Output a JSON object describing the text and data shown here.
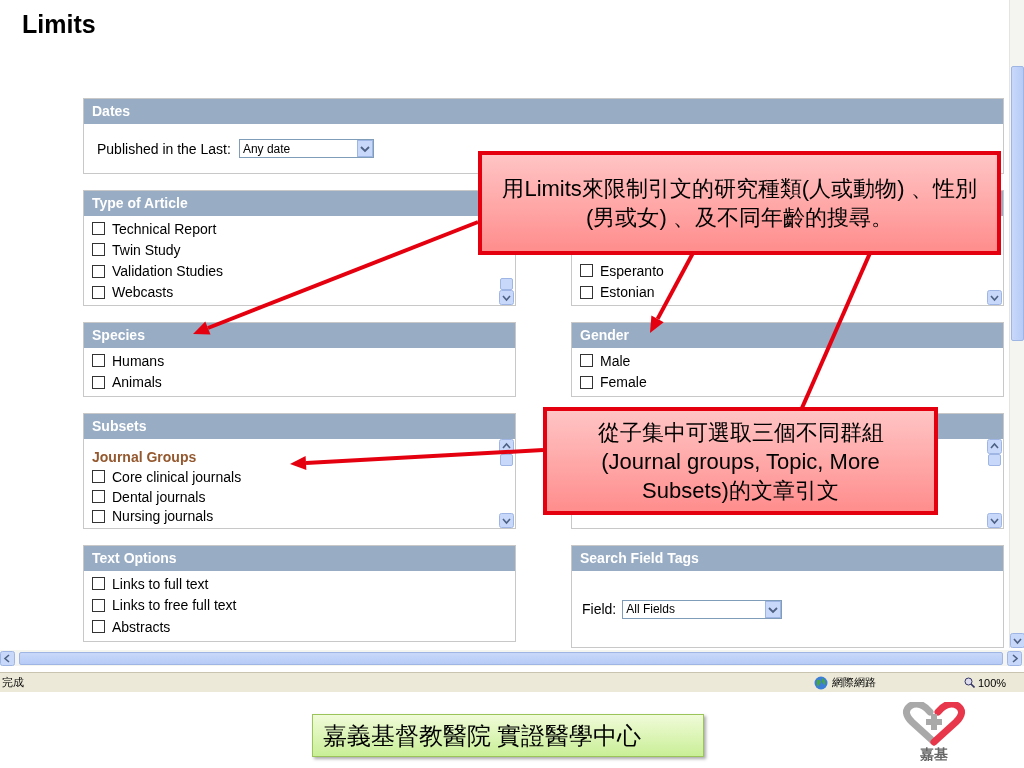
{
  "page_title": "Limits",
  "dates": {
    "title": "Dates",
    "label": "Published in the Last:",
    "value": "Any date"
  },
  "panels": [
    {
      "kind": "list",
      "title": "Type of Article",
      "items": [
        {
          "label": "Technical Report",
          "checked": false
        },
        {
          "label": "Twin Study",
          "checked": false
        },
        {
          "label": "Validation Studies",
          "checked": false
        },
        {
          "label": "Webcasts",
          "checked": false
        }
      ]
    },
    {
      "kind": "list",
      "items": [
        {
          "label": "Esperanto",
          "checked": false
        },
        {
          "label": "Estonian",
          "checked": false
        }
      ]
    },
    {
      "kind": "checks",
      "title": "Species",
      "items": [
        {
          "label": "Humans",
          "checked": false
        },
        {
          "label": "Animals",
          "checked": false
        }
      ]
    },
    {
      "kind": "checks",
      "title": "Gender",
      "items": [
        {
          "label": "Male",
          "checked": false
        },
        {
          "label": "Female",
          "checked": false
        }
      ]
    },
    {
      "kind": "list",
      "title": "Subsets",
      "group": "Journal Groups",
      "items": [
        {
          "label": "Core clinical journals",
          "checked": false
        },
        {
          "label": "Dental journals",
          "checked": false
        },
        {
          "label": "Nursing journals",
          "checked": false
        }
      ]
    },
    {
      "kind": "list"
    },
    {
      "kind": "checks",
      "title": "Text Options",
      "items": [
        {
          "label": "Links to full text",
          "checked": false
        },
        {
          "label": "Links to free full text",
          "checked": false
        },
        {
          "label": "Abstracts",
          "checked": false
        }
      ]
    },
    {
      "kind": "select",
      "title": "Search Field Tags",
      "label": "Field:",
      "value": "All Fields"
    }
  ],
  "status_bar": {
    "status": "完成",
    "zone": "網際網路",
    "zoom": "100%"
  },
  "callouts": [
    {
      "text": "用Limits來限制引文的研究種類(人或動物) 、性別(男或女) 、及不同年齡的搜尋。"
    },
    {
      "text": "從子集中可選取三個不同群組(Journal groups, Topic, More Subsets)的文章引文"
    }
  ],
  "footer": {
    "caption": "嘉義基督教醫院  實證醫學中心",
    "logo_text": "嘉基"
  }
}
